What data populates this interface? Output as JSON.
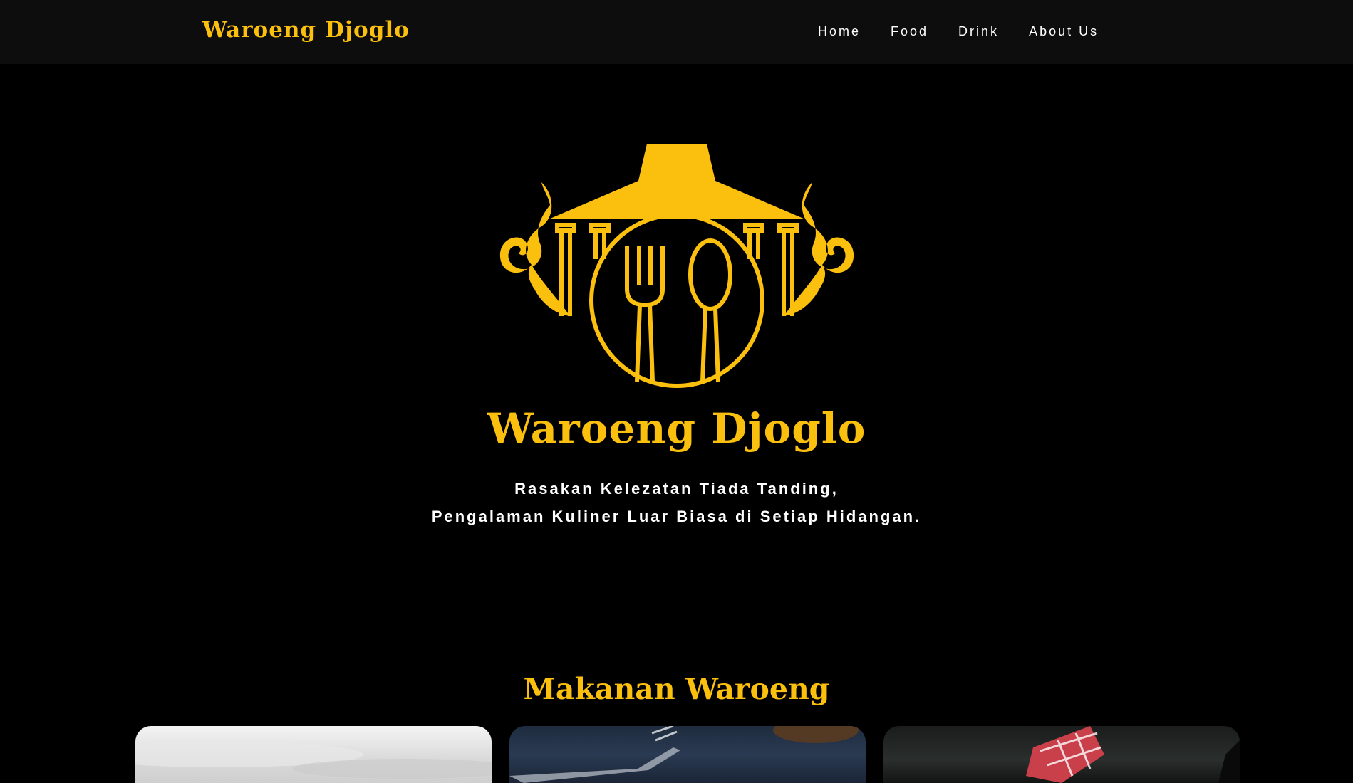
{
  "navbar": {
    "brand": "Waroeng Djoglo",
    "links": [
      "Home",
      "Food",
      "Drink",
      "About Us"
    ]
  },
  "hero": {
    "title": "Waroeng Djoglo",
    "tagline_line1": "Rasakan Kelezatan Tiada Tanding,",
    "tagline_line2": "Pengalaman Kuliner Luar Biasa di Setiap Hidangan."
  },
  "menu_section": {
    "title": "Makanan Waroeng"
  },
  "colors": {
    "accent": "#fbbf0e",
    "background": "#000000",
    "navbar": "#0d0d0d"
  },
  "icons": {
    "logo": "joglo-roof-fork-spoon-logo"
  }
}
